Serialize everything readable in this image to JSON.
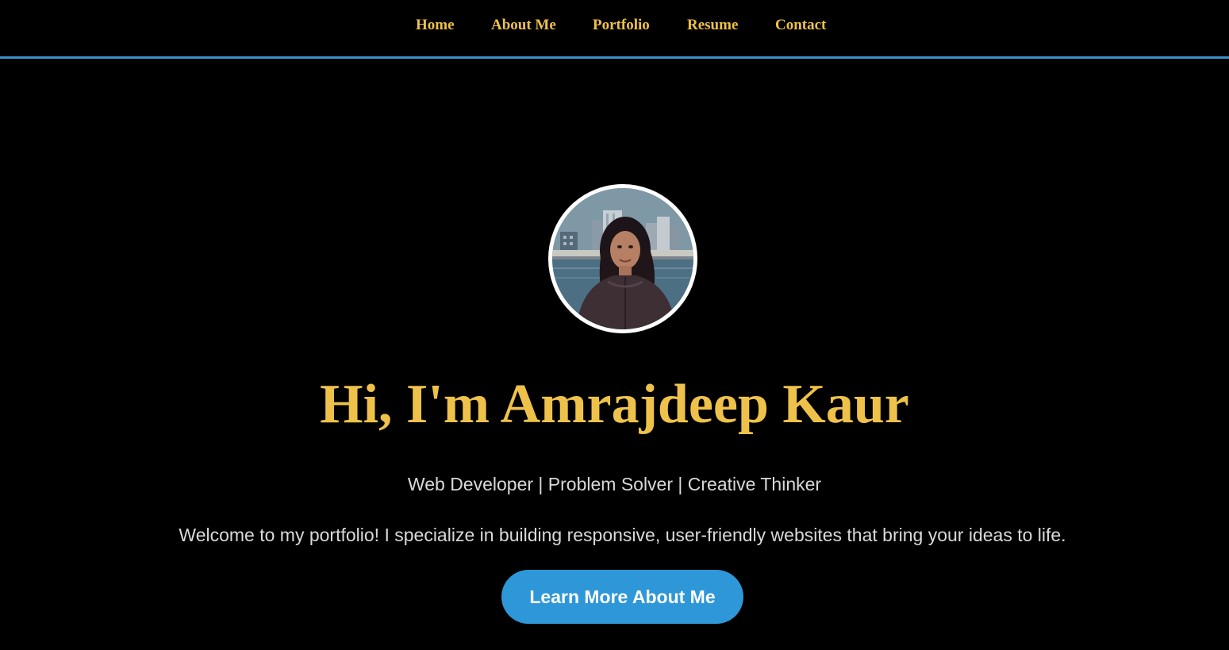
{
  "nav": {
    "items": [
      {
        "label": "Home"
      },
      {
        "label": "About Me"
      },
      {
        "label": "Portfolio"
      },
      {
        "label": "Resume"
      },
      {
        "label": "Contact"
      }
    ]
  },
  "hero": {
    "title": "Hi, I'm Amrajdeep Kaur",
    "tagline": "Web Developer | Problem Solver | Creative Thinker",
    "welcome": "Welcome to my portfolio! I specialize in building responsive, user-friendly websites that bring your ideas to life.",
    "cta_label": "Learn More About Me"
  },
  "colors": {
    "background": "#000000",
    "accent": "#eec24a",
    "nav_border": "#3a8fcd",
    "button": "#2e97d8",
    "body_text": "#d9d9d9"
  }
}
